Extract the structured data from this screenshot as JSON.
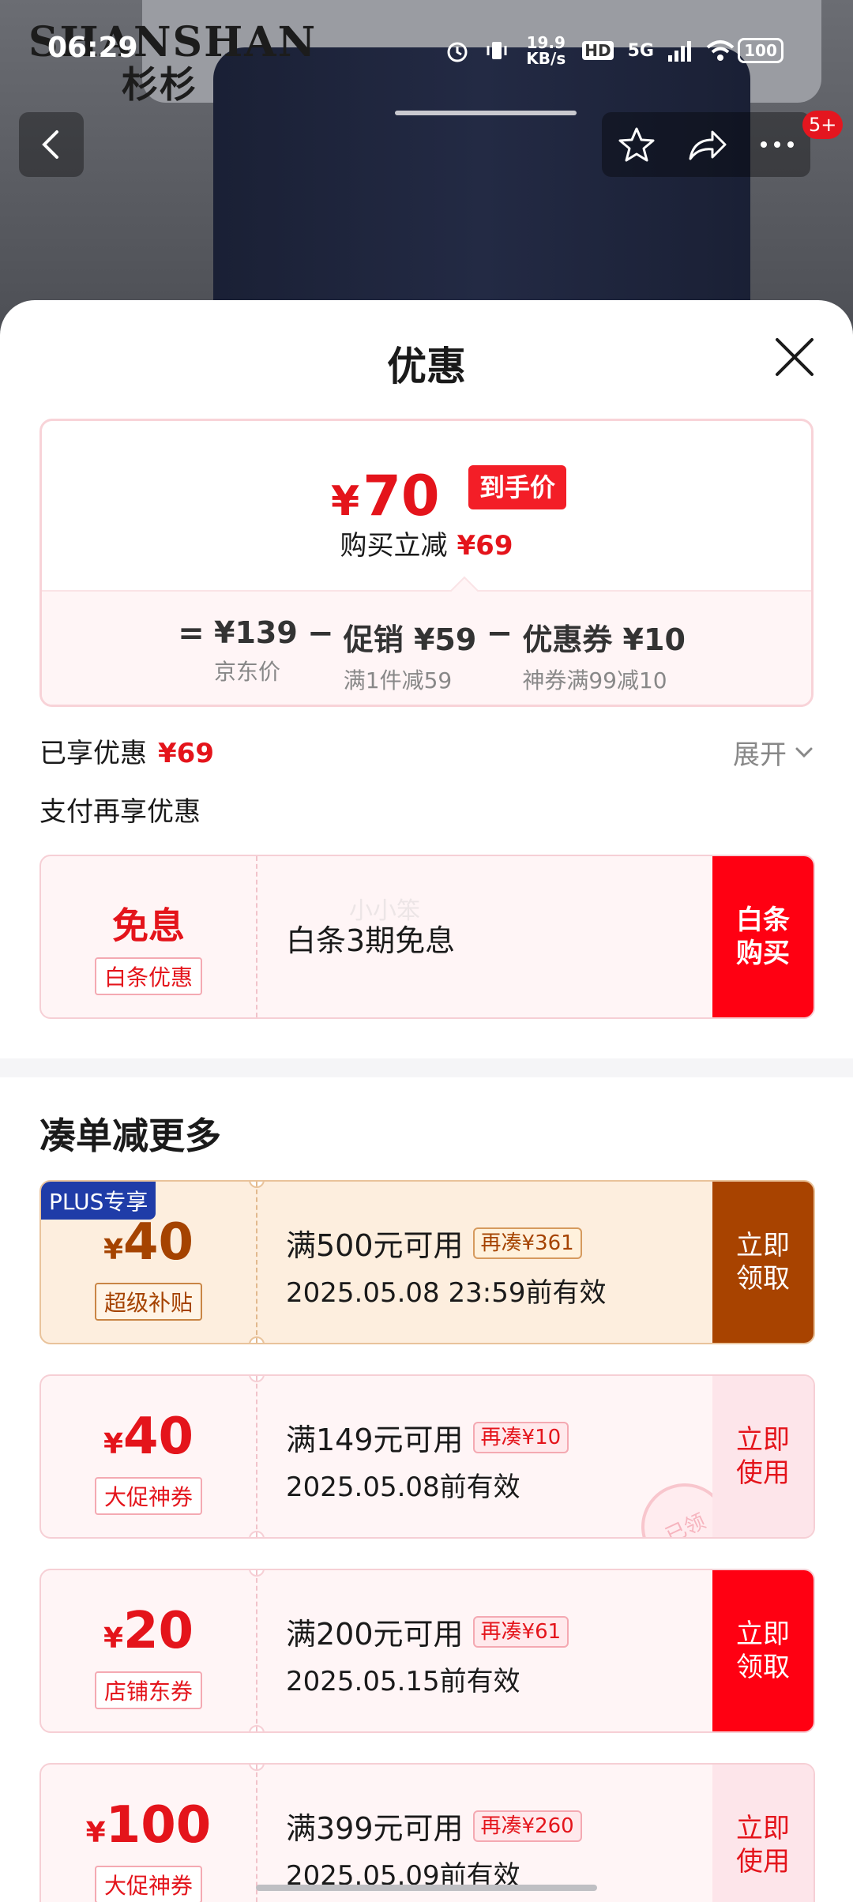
{
  "status_bar": {
    "time": "06:29",
    "net_speed": "19.9 KB/s",
    "hd": "HD",
    "network": "5G",
    "battery": "100"
  },
  "brand": {
    "en": "SHANSHAN",
    "cn": "杉杉"
  },
  "top_bar": {
    "notification_badge": "5+"
  },
  "sheet": {
    "title": "优惠",
    "price": {
      "final_currency": "¥",
      "final_value": "70",
      "final_tag": "到手价",
      "instant_cut_label": "购买立减",
      "instant_cut_amount": "¥69",
      "equals": "=",
      "minus": "−",
      "terms": [
        {
          "main": "¥139",
          "sub": "京东价"
        },
        {
          "main": "促销 ¥59",
          "sub": "满1件减59"
        },
        {
          "main": "优惠券 ¥10",
          "sub": "神券满99减10"
        }
      ]
    },
    "enjoyed_label": "已享优惠",
    "enjoyed_amount": "¥69",
    "expand_label": "展开",
    "pay_more_label": "支付再享优惠",
    "baitiao_card": {
      "title": "免息",
      "tag": "白条优惠",
      "desc": "白条3期免息",
      "watermark": "小小笨",
      "action": "白条\n购买"
    },
    "section_title": "凑单减更多",
    "coupons": [
      {
        "badge": "PLUS专享",
        "currency": "¥",
        "amount": "40",
        "tag": "超级补贴",
        "condition": "满500元可用",
        "more": "再凑¥361",
        "validity": "2025.05.08 23:59前有效",
        "action": "立即\n领取",
        "style": "plus"
      },
      {
        "currency": "¥",
        "amount": "40",
        "tag": "大促神券",
        "condition": "满149元可用",
        "more": "再凑¥10",
        "validity": "2025.05.08前有效",
        "action": "立即\n使用",
        "stamp": "已领",
        "style": "ghost"
      },
      {
        "currency": "¥",
        "amount": "20",
        "tag": "店铺东券",
        "condition": "满200元可用",
        "more": "再凑¥61",
        "validity": "2025.05.15前有效",
        "action": "立即\n领取",
        "style": "solid"
      },
      {
        "currency": "¥",
        "amount": "100",
        "tag": "大促神券",
        "condition": "满399元可用",
        "more": "再凑¥260",
        "validity": "2025.05.09前有效",
        "action": "立即\n使用",
        "style": "ghost"
      }
    ]
  },
  "colors": {
    "accent_red": "#e4141b",
    "button_red": "#ff0012",
    "plus_brown": "#a84300",
    "plus_badge_blue": "#1f3ca8"
  }
}
